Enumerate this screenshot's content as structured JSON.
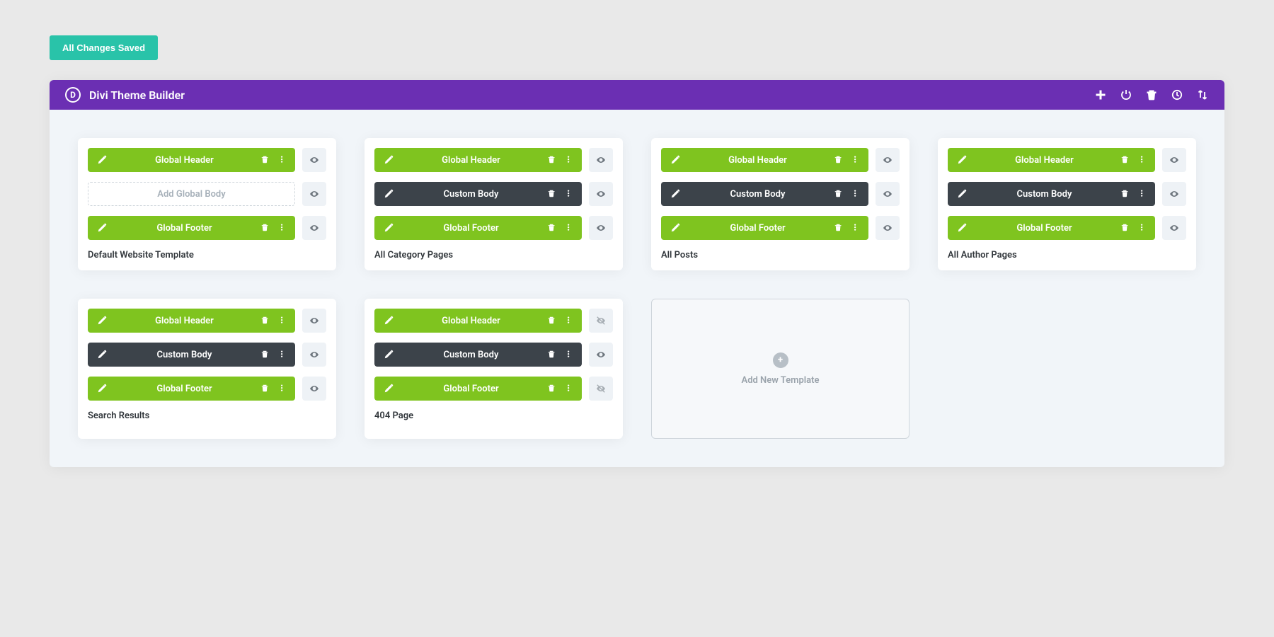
{
  "save_button": "All Changes Saved",
  "header": {
    "logo_letter": "D",
    "title": "Divi Theme Builder",
    "actions": [
      "add",
      "power",
      "trash",
      "history",
      "portability"
    ]
  },
  "bar_labels": {
    "global_header": "Global Header",
    "global_footer": "Global Footer",
    "custom_body": "Custom Body",
    "add_global_body": "Add Global Body"
  },
  "add_new_template": "Add New Template",
  "templates": [
    {
      "name": "Default Website Template",
      "rows": [
        {
          "type": "green",
          "label_key": "global_header",
          "eye": "visible"
        },
        {
          "type": "dashed",
          "label_key": "add_global_body",
          "eye": "visible"
        },
        {
          "type": "green",
          "label_key": "global_footer",
          "eye": "visible"
        }
      ]
    },
    {
      "name": "All Category Pages",
      "rows": [
        {
          "type": "green",
          "label_key": "global_header",
          "eye": "visible"
        },
        {
          "type": "dark",
          "label_key": "custom_body",
          "eye": "visible"
        },
        {
          "type": "green",
          "label_key": "global_footer",
          "eye": "visible"
        }
      ]
    },
    {
      "name": "All Posts",
      "rows": [
        {
          "type": "green",
          "label_key": "global_header",
          "eye": "visible"
        },
        {
          "type": "dark",
          "label_key": "custom_body",
          "eye": "visible"
        },
        {
          "type": "green",
          "label_key": "global_footer",
          "eye": "visible"
        }
      ]
    },
    {
      "name": "All Author Pages",
      "rows": [
        {
          "type": "green",
          "label_key": "global_header",
          "eye": "visible"
        },
        {
          "type": "dark",
          "label_key": "custom_body",
          "eye": "visible"
        },
        {
          "type": "green",
          "label_key": "global_footer",
          "eye": "visible"
        }
      ]
    },
    {
      "name": "Search Results",
      "rows": [
        {
          "type": "green",
          "label_key": "global_header",
          "eye": "visible"
        },
        {
          "type": "dark",
          "label_key": "custom_body",
          "eye": "visible"
        },
        {
          "type": "green",
          "label_key": "global_footer",
          "eye": "visible"
        }
      ]
    },
    {
      "name": "404 Page",
      "rows": [
        {
          "type": "green",
          "label_key": "global_header",
          "eye": "disabled"
        },
        {
          "type": "dark",
          "label_key": "custom_body",
          "eye": "visible"
        },
        {
          "type": "green",
          "label_key": "global_footer",
          "eye": "disabled"
        }
      ]
    }
  ]
}
